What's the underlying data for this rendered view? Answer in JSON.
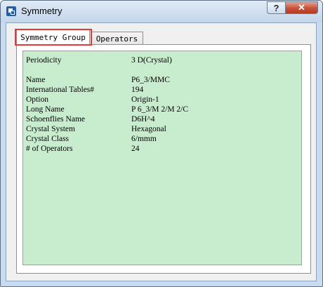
{
  "window": {
    "title": "Symmetry",
    "help_label": "?",
    "close_label": "✕"
  },
  "tabs": [
    {
      "label": "Symmetry Group",
      "selected": true
    },
    {
      "label": "Operators",
      "selected": false
    }
  ],
  "symmetry_group": {
    "periodicity": {
      "label": "Periodicity",
      "value": "3 D(Crystal)"
    },
    "fields": [
      {
        "label": "Name",
        "value": "P6_3/MMC"
      },
      {
        "label": "International Tables#",
        "value": "194"
      },
      {
        "label": "Option",
        "value": "Origin-1"
      },
      {
        "label": "Long Name",
        "value": "P 6_3/M 2/M 2/C"
      },
      {
        "label": "Schoenflies Name",
        "value": "D6H^4"
      },
      {
        "label": "Crystal System",
        "value": "Hexagonal"
      },
      {
        "label": "Crystal Class",
        "value": "6/mmm"
      },
      {
        "label": "# of Operators",
        "value": "24"
      }
    ]
  },
  "colors": {
    "panel_background": "#c8ecce",
    "highlight": "#e53935"
  },
  "icons": {
    "app": "app-window-icon"
  }
}
